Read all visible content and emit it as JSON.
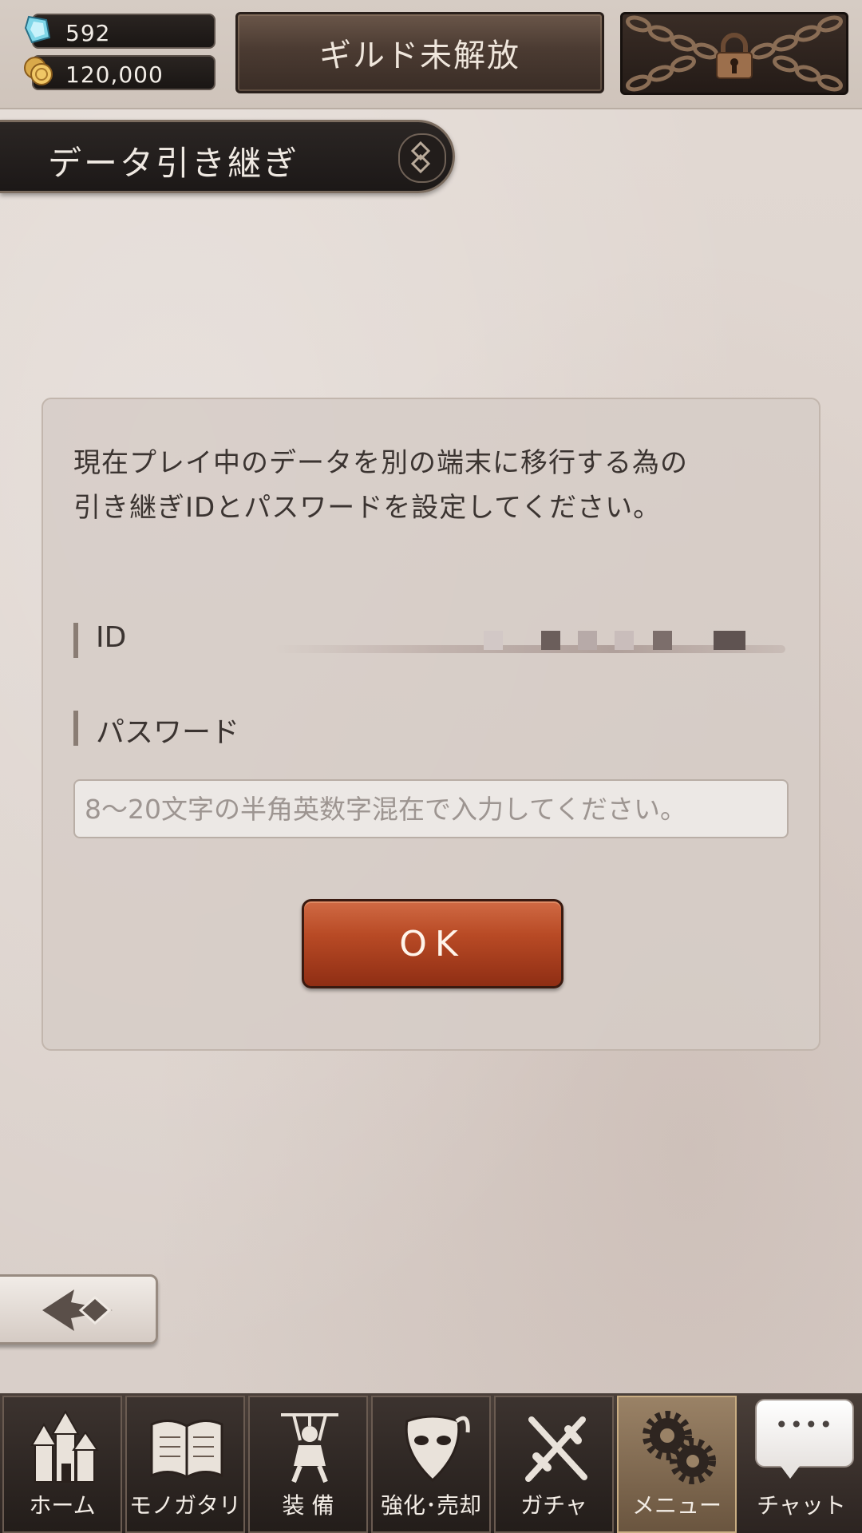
{
  "currency": {
    "gems": "592",
    "gold": "120,000"
  },
  "header": {
    "guild_label": "ギルド未解放"
  },
  "page": {
    "title": "データ引き継ぎ"
  },
  "dialog": {
    "description_line1": "現在プレイ中のデータを別の端末に移行する為の",
    "description_line2": "引き継ぎIDとパスワードを設定してください。",
    "id_label": "ID",
    "password_label": "パスワード",
    "password_placeholder": "8～20文字の半角英数字混在で入力してください。",
    "ok_label": "OK"
  },
  "nav": {
    "items": [
      {
        "label": "ホーム",
        "icon": "home-castle-icon"
      },
      {
        "label": "モノガタリ",
        "icon": "story-book-icon"
      },
      {
        "label": "装 備",
        "icon": "equipment-puppet-icon"
      },
      {
        "label": "強化･売却",
        "icon": "enhance-mask-icon"
      },
      {
        "label": "ガチャ",
        "icon": "gacha-swords-icon"
      },
      {
        "label": "メニュー",
        "icon": "menu-gears-icon"
      }
    ],
    "chat_label": "チャット",
    "chat_bubble": "••••"
  }
}
